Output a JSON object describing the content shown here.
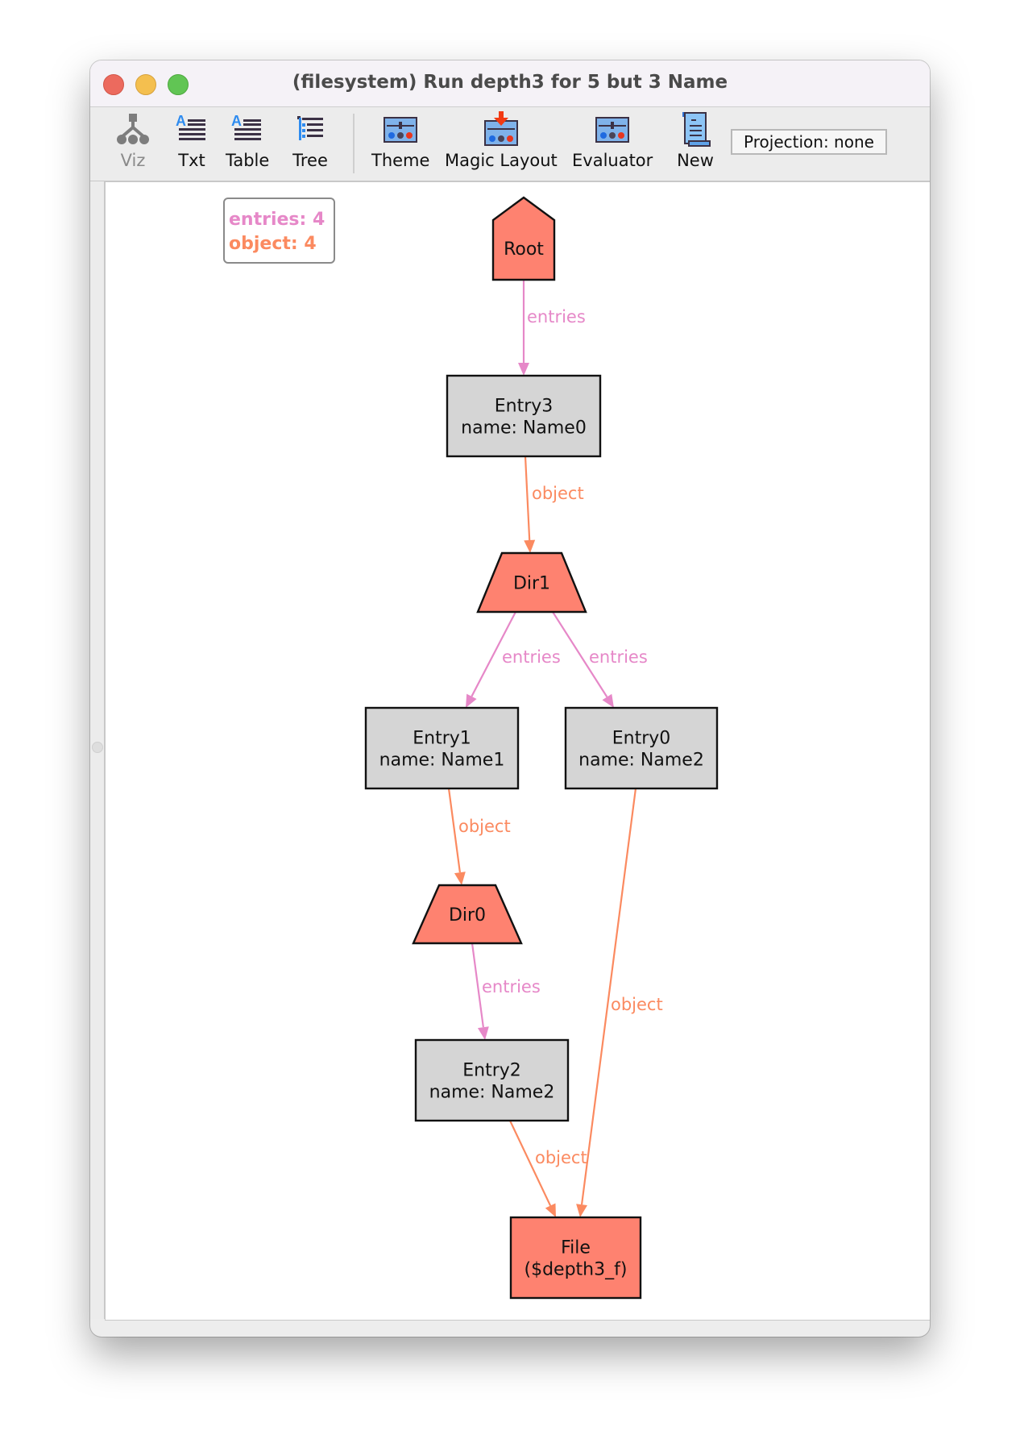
{
  "window": {
    "title": "(filesystem) Run depth3 for 5 but 3 Name"
  },
  "toolbar": {
    "items": [
      {
        "id": "viz",
        "label": "Viz",
        "icon": "graph-icon",
        "disabled": true
      },
      {
        "id": "txt",
        "label": "Txt",
        "icon": "text-icon"
      },
      {
        "id": "table",
        "label": "Table",
        "icon": "table-icon"
      },
      {
        "id": "tree",
        "label": "Tree",
        "icon": "tree-icon"
      },
      {
        "id": "theme",
        "label": "Theme",
        "icon": "theme-icon"
      },
      {
        "id": "magic_layout",
        "label": "Magic Layout",
        "icon": "magic-layout-icon"
      },
      {
        "id": "evaluator",
        "label": "Evaluator",
        "icon": "evaluator-icon"
      },
      {
        "id": "new",
        "label": "New",
        "icon": "new-scroll-icon"
      }
    ],
    "projection_label": "Projection: none"
  },
  "legend": {
    "entries_label": "entries: 4",
    "object_label": "object: 4"
  },
  "colors": {
    "entries_edge": "#e688c8",
    "object_edge": "#fb8a60",
    "sig_node_fill": "#fe8270",
    "entry_node_fill": "#d5d5d5"
  },
  "graph": {
    "nodes": [
      {
        "id": "root",
        "shape": "house",
        "fill": "sig",
        "lines": [
          "Root"
        ]
      },
      {
        "id": "entry3",
        "shape": "box",
        "fill": "entry",
        "lines": [
          "Entry3",
          "name: Name0"
        ]
      },
      {
        "id": "dir1",
        "shape": "trapezium",
        "fill": "sig",
        "lines": [
          "Dir1"
        ]
      },
      {
        "id": "entry1",
        "shape": "box",
        "fill": "entry",
        "lines": [
          "Entry1",
          "name: Name1"
        ]
      },
      {
        "id": "entry0",
        "shape": "box",
        "fill": "entry",
        "lines": [
          "Entry0",
          "name: Name2"
        ]
      },
      {
        "id": "dir0",
        "shape": "trapezium",
        "fill": "sig",
        "lines": [
          "Dir0"
        ]
      },
      {
        "id": "entry2",
        "shape": "box",
        "fill": "entry",
        "lines": [
          "Entry2",
          "name: Name2"
        ]
      },
      {
        "id": "file",
        "shape": "box",
        "fill": "sig",
        "lines": [
          "File",
          "($depth3_f)"
        ]
      }
    ],
    "edges": [
      {
        "from": "root",
        "to": "entry3",
        "label": "entries"
      },
      {
        "from": "entry3",
        "to": "dir1",
        "label": "object"
      },
      {
        "from": "dir1",
        "to": "entry1",
        "label": "entries"
      },
      {
        "from": "dir1",
        "to": "entry0",
        "label": "entries"
      },
      {
        "from": "entry1",
        "to": "dir0",
        "label": "object"
      },
      {
        "from": "dir0",
        "to": "entry2",
        "label": "entries"
      },
      {
        "from": "entry2",
        "to": "file",
        "label": "object"
      },
      {
        "from": "entry0",
        "to": "file",
        "label": "object"
      }
    ]
  }
}
